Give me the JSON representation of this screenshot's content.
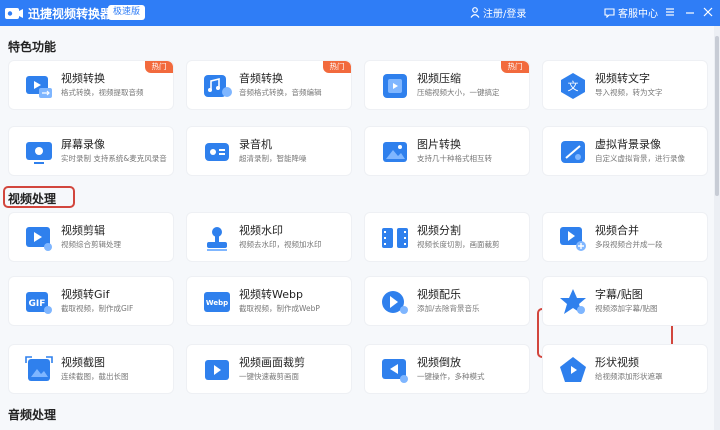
{
  "app": {
    "title": "迅捷视频转换器",
    "edition": "极速版"
  },
  "header": {
    "login_label": "注册/登录",
    "support_label": "客服中心"
  },
  "sections": [
    {
      "title": "特色功能"
    },
    {
      "title": "视频处理"
    },
    {
      "title": "音频处理"
    }
  ],
  "cards": [
    {
      "name": "视频转换",
      "desc": "格式转换，视频提取音频",
      "badge": "热门"
    },
    {
      "name": "音频转换",
      "desc": "音频格式转换，音频编辑",
      "badge": "热门"
    },
    {
      "name": "视频压缩",
      "desc": "压缩视频大小，一键搞定",
      "badge": "热门"
    },
    {
      "name": "视频转文字",
      "desc": "导入视频，转为文字",
      "badge": ""
    },
    {
      "name": "屏幕录像",
      "desc": "实时录制 支持系统&麦克风录音",
      "badge": ""
    },
    {
      "name": "录音机",
      "desc": "超清录制，智能降噪",
      "badge": ""
    },
    {
      "name": "图片转换",
      "desc": "支持几十种格式相互转",
      "badge": ""
    },
    {
      "name": "虚拟背景录像",
      "desc": "自定义虚拟背景，进行录像",
      "badge": ""
    },
    {
      "name": "视频剪辑",
      "desc": "视频综合剪辑处理",
      "badge": ""
    },
    {
      "name": "视频水印",
      "desc": "视频去水印，视频加水印",
      "badge": ""
    },
    {
      "name": "视频分割",
      "desc": "视频长度切割，画面裁剪",
      "badge": ""
    },
    {
      "name": "视频合并",
      "desc": "多段视频合并成一段",
      "badge": ""
    },
    {
      "name": "视频转Gif",
      "desc": "截取视频，制作成GIF",
      "badge": ""
    },
    {
      "name": "视频转Webp",
      "desc": "截取视频，制作成WebP",
      "badge": ""
    },
    {
      "name": "视频配乐",
      "desc": "添加/去除背景音乐",
      "badge": ""
    },
    {
      "name": "字幕/贴图",
      "desc": "视频添加字幕/贴图",
      "badge": ""
    },
    {
      "name": "视频截图",
      "desc": "连续截图，截出长图",
      "badge": ""
    },
    {
      "name": "视频画面裁剪",
      "desc": "一键快速裁剪画面",
      "badge": ""
    },
    {
      "name": "视频倒放",
      "desc": "一键操作，多种模式",
      "badge": ""
    },
    {
      "name": "形状视频",
      "desc": "给视频添加形状遮罩",
      "badge": ""
    }
  ],
  "icons": {
    "logo": "app-logo-icon",
    "login": "user-icon",
    "support": "chat-icon",
    "window": [
      "menu-icon",
      "minimize-icon",
      "close-icon"
    ]
  },
  "colors": {
    "titlebar": "#2f7df6",
    "hot_badge": "#f26a3d",
    "highlight": "#d2463d",
    "icon_blue": "#2f80ed"
  }
}
